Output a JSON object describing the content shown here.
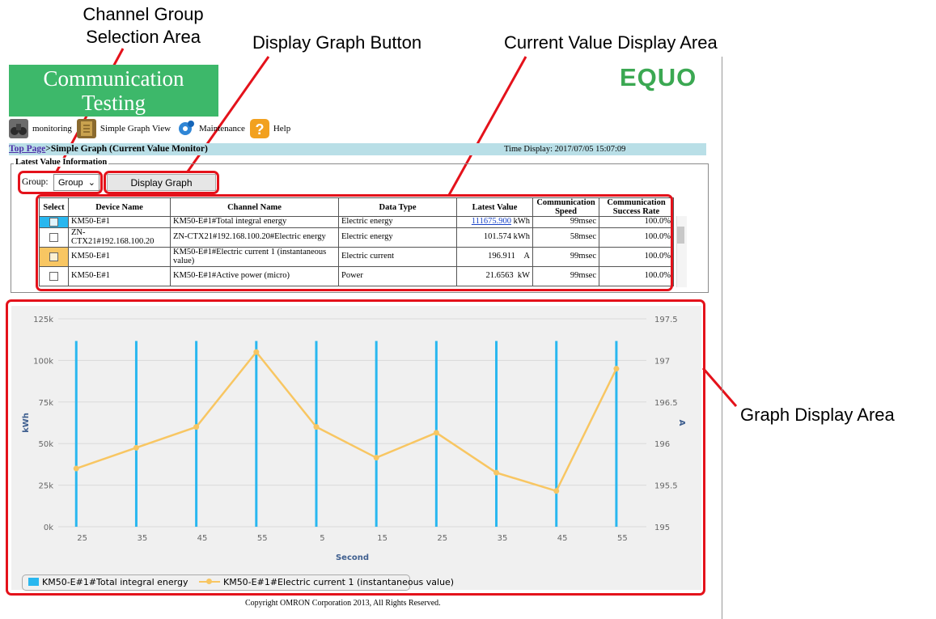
{
  "callouts": {
    "channel_group_line1": "Channel Group",
    "channel_group_line2": "Selection Area",
    "display_graph": "Display Graph Button",
    "current_value": "Current Value Display Area",
    "graph_display": "Graph Display Area"
  },
  "header": {
    "logo_line1": "Communication",
    "logo_line2": "Testing",
    "brand": "EQUO"
  },
  "nav": {
    "monitoring": "monitoring",
    "simple_graph": "Simple Graph View",
    "maintenance": "Maintenance",
    "help": "Help"
  },
  "breadcrumb": {
    "top": "Top Page",
    "separator": ">",
    "current": "Simple Graph (Current Value Monitor)",
    "time_display": "Time Display:  2017/07/05 15:07:09"
  },
  "section": {
    "legend": "Latest Value Information"
  },
  "controls": {
    "group_label": "Group:",
    "group_value": "Group",
    "display_button": "Display Graph"
  },
  "table": {
    "headers": [
      "Select",
      "Device Name",
      "Channel Name",
      "Data Type",
      "Latest Value",
      "Communication Speed",
      "Communication Success Rate"
    ],
    "rows": [
      {
        "selected": "blue",
        "device": "KM50-E#1",
        "channel": "KM50-E#1#Total integral energy",
        "type": "Electric energy",
        "value": "111675.900",
        "unit": "kWh",
        "speed": "99msec",
        "rate": "100.0%"
      },
      {
        "selected": "none",
        "device": "ZN-CTX21#192.168.100.20",
        "channel": "ZN-CTX21#192.168.100.20#Electric energy",
        "type": "Electric energy",
        "value": "101.574",
        "unit": "kWh",
        "speed": "58msec",
        "rate": "100.0%"
      },
      {
        "selected": "orange",
        "device": "KM50-E#1",
        "channel": "KM50-E#1#Electric current 1 (instantaneous value)",
        "type": "Electric current",
        "value": "196.911",
        "unit": "A",
        "speed": "99msec",
        "rate": "100.0%"
      },
      {
        "selected": "none",
        "device": "KM50-E#1",
        "channel": "KM50-E#1#Active power (micro)",
        "type": "Power",
        "value": "21.6563",
        "unit": "kW",
        "speed": "99msec",
        "rate": "100.0%"
      }
    ]
  },
  "chart_data": {
    "type": "bar+line",
    "xlabel": "Second",
    "ylabel_left": "kWh",
    "ylabel_right": "A",
    "x_ticks": [
      "25",
      "35",
      "45",
      "55",
      "5",
      "15",
      "25",
      "35",
      "45",
      "55"
    ],
    "ylim_left": [
      0,
      125000
    ],
    "yticks_left": [
      "0k",
      "25k",
      "50k",
      "75k",
      "100k",
      "125k"
    ],
    "ylim_right": [
      195,
      197.5
    ],
    "yticks_right": [
      "195",
      "195.5",
      "196",
      "196.5",
      "197",
      "197.5"
    ],
    "grid": true,
    "legend_position": "bottom-left",
    "series": [
      {
        "name": "KM50-E#1#Total integral energy",
        "axis": "left",
        "kind": "bar",
        "color": "#29b7ef",
        "x": [
          -1,
          9,
          19,
          29,
          39,
          49,
          59,
          69,
          79,
          89
        ],
        "values": [
          111675.9,
          111675.9,
          111675.9,
          111675.9,
          111675.9,
          111675.9,
          111675.9,
          111675.9,
          111675.9,
          111675.9
        ]
      },
      {
        "name": "KM50-E#1#Electric current 1 (instantaneous value)",
        "axis": "right",
        "kind": "line",
        "color": "#f8c662",
        "x": [
          -1,
          9,
          19,
          29,
          39,
          49,
          59,
          69,
          79,
          89
        ],
        "values": [
          195.7,
          195.95,
          196.2,
          197.1,
          196.2,
          195.83,
          196.13,
          195.65,
          195.43,
          196.9
        ]
      }
    ]
  },
  "footer": {
    "copyright": "Copyright OMRON Corporation 2013, All Rights Reserved."
  }
}
